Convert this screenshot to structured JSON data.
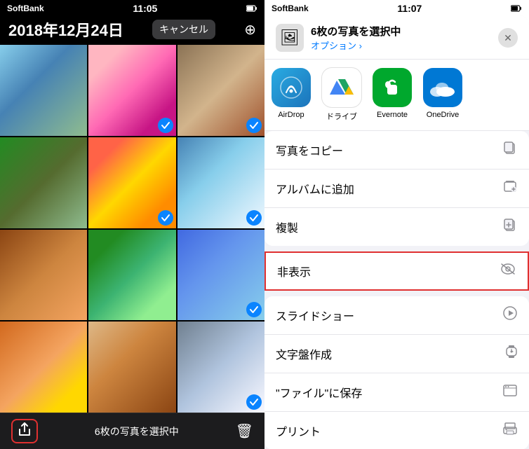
{
  "left": {
    "carrier": "SoftBank",
    "time": "11:05",
    "date": "2018年12月24日",
    "cancel_btn": "キャンセル",
    "plus_btn": "/+",
    "bottom_count": "6枚の写真を選択中",
    "photos": [
      {
        "id": 1,
        "class": "p1",
        "selected": false
      },
      {
        "id": 2,
        "class": "p2",
        "selected": true
      },
      {
        "id": 3,
        "class": "p3",
        "selected": true
      },
      {
        "id": 4,
        "class": "p4",
        "selected": false
      },
      {
        "id": 5,
        "class": "p5",
        "selected": true
      },
      {
        "id": 6,
        "class": "p6",
        "selected": true
      },
      {
        "id": 7,
        "class": "p7",
        "selected": false
      },
      {
        "id": 8,
        "class": "p8",
        "selected": false
      },
      {
        "id": 9,
        "class": "p9",
        "selected": true
      },
      {
        "id": 10,
        "class": "p10",
        "selected": false
      },
      {
        "id": 11,
        "class": "p11",
        "selected": false
      },
      {
        "id": 12,
        "class": "p12",
        "selected": true
      }
    ]
  },
  "right": {
    "carrier": "SoftBank",
    "time": "11:07",
    "sheet": {
      "title": "6枚の写真を選択中",
      "subtitle": "オプション ›",
      "close_btn": "✕"
    },
    "apps": [
      {
        "id": "airdrop",
        "label": "AirDrop",
        "icon_type": "airdrop"
      },
      {
        "id": "drive",
        "label": "ドライブ",
        "icon_type": "drive"
      },
      {
        "id": "evernote",
        "label": "Evernote",
        "icon_type": "evernote"
      },
      {
        "id": "onedrive",
        "label": "OneDrive",
        "icon_type": "onedrive"
      }
    ],
    "actions": [
      {
        "id": "copy-photo",
        "label": "写真をコピー",
        "icon": "📋",
        "highlighted": false
      },
      {
        "id": "add-album",
        "label": "アルバムに追加",
        "icon": "🗂",
        "highlighted": false
      },
      {
        "id": "duplicate",
        "label": "複製",
        "icon": "📋",
        "highlighted": false
      },
      {
        "id": "hide",
        "label": "非表示",
        "icon": "👁",
        "highlighted": true
      },
      {
        "id": "slideshow",
        "label": "スライドショー",
        "icon": "▶",
        "highlighted": false
      },
      {
        "id": "watch-face",
        "label": "文字盤作成",
        "icon": "⌚",
        "highlighted": false
      },
      {
        "id": "save-files",
        "label": "\"ファイル\"に保存",
        "icon": "🗂",
        "highlighted": false
      },
      {
        "id": "print",
        "label": "プリント",
        "icon": "🖨",
        "highlighted": false
      }
    ]
  }
}
